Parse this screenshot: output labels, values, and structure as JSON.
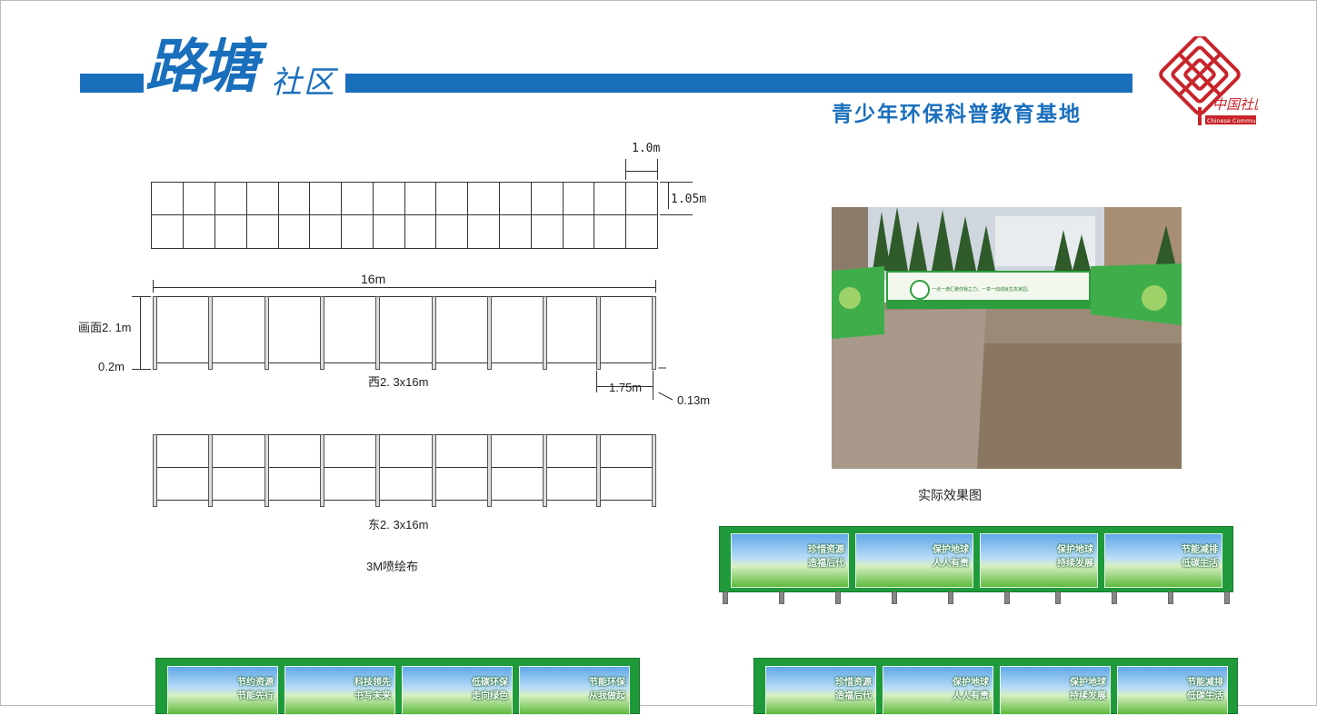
{
  "header": {
    "brand_main": "路塘",
    "brand_sub": "社区",
    "subtitle": "青少年环保科普教育基地",
    "logo_text": "中国社区",
    "logo_caption": "Chinese Community",
    "colors": {
      "brand_blue": "#1a6fbd",
      "logo_red": "#c8242b",
      "board_green": "#1f9a3a"
    }
  },
  "drawings": {
    "top_panel_dim_width": "1.0m",
    "top_panel_dim_height": "1.05m",
    "total_length": "16m",
    "screen_height": "画面2. 1m",
    "base_height": "0.2m",
    "west_caption": "西2. 3x16m",
    "post_spacing": "1.75m",
    "post_width": "0.13m",
    "east_caption": "东2. 3x16m",
    "material": "3M喷绘布"
  },
  "photo": {
    "caption": "实际效果图",
    "banner_text": "一点一滴汇聚你我之力，一举一动成就生态家园。"
  },
  "boards": {
    "right_mid": [
      {
        "line1": "珍惜资源",
        "line2": "造福后代"
      },
      {
        "line1": "保护地球",
        "line2": "人人有责"
      },
      {
        "line1": "保护地球",
        "line2": "持续发展"
      },
      {
        "line1": "节能减排",
        "line2": "低碳生活"
      }
    ],
    "bottom_left": [
      {
        "line1": "节约资源",
        "line2": "节能先行"
      },
      {
        "line1": "科技领先",
        "line2": "书写未来"
      },
      {
        "line1": "低碳环保",
        "line2": "走向绿色"
      },
      {
        "line1": "节能环保",
        "line2": "从我做起"
      }
    ],
    "bottom_right": [
      {
        "line1": "珍惜资源",
        "line2": "造福后代"
      },
      {
        "line1": "保护地球",
        "line2": "人人有责"
      },
      {
        "line1": "保护地球",
        "line2": "持续发展"
      },
      {
        "line1": "节能减排",
        "line2": "低碳生活"
      }
    ]
  }
}
